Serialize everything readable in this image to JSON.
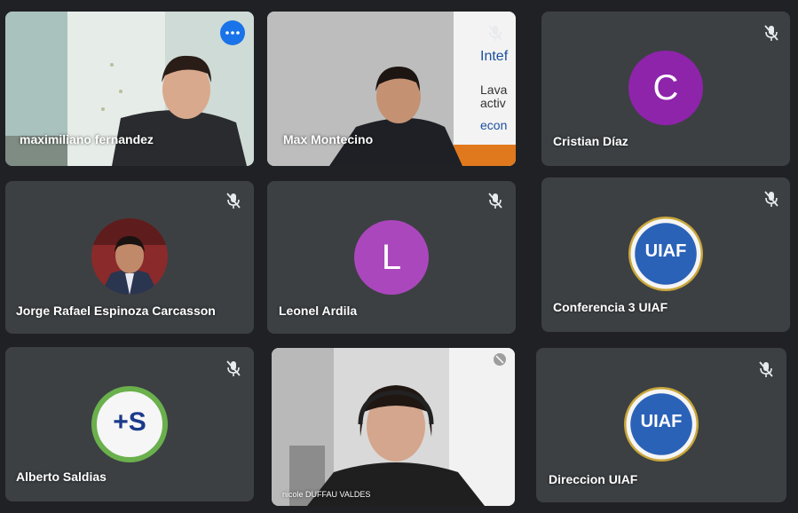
{
  "participants": [
    {
      "name": "maximiliano fernandez",
      "type": "video",
      "active": true
    },
    {
      "name": "Max Montecino",
      "type": "video"
    },
    {
      "name": "Cristian Díaz",
      "type": "letter",
      "letter": "C",
      "color": "#8e24aa"
    },
    {
      "name": "Jorge Rafael Espinoza Carcasson",
      "type": "photo"
    },
    {
      "name": "Leonel Ardila",
      "type": "letter",
      "letter": "L",
      "color": "#ab47bc"
    },
    {
      "name": "Conferencia 3 UIAF",
      "type": "logo",
      "logo_text": "UIAF"
    },
    {
      "name": "Alberto Saldias",
      "type": "logo",
      "logo_text": "+S"
    },
    {
      "name": "nicole DUFFAU VALDES",
      "type": "video"
    },
    {
      "name": "Direccion UIAF",
      "type": "logo",
      "logo_text": "UIAF"
    }
  ],
  "banner_text": [
    "Intef",
    "Lava",
    "activ",
    "econ"
  ],
  "icons": {
    "mic_off": "mic-off-icon",
    "more": "more-options-icon"
  },
  "colors": {
    "tile_bg": "#3c4043",
    "page_bg": "#202124",
    "active_outline": "#8ab4f8",
    "uiaf_blue": "#1b4f9c",
    "uiaf_gold": "#c9a63a",
    "saldias_green": "#6ab04c"
  }
}
